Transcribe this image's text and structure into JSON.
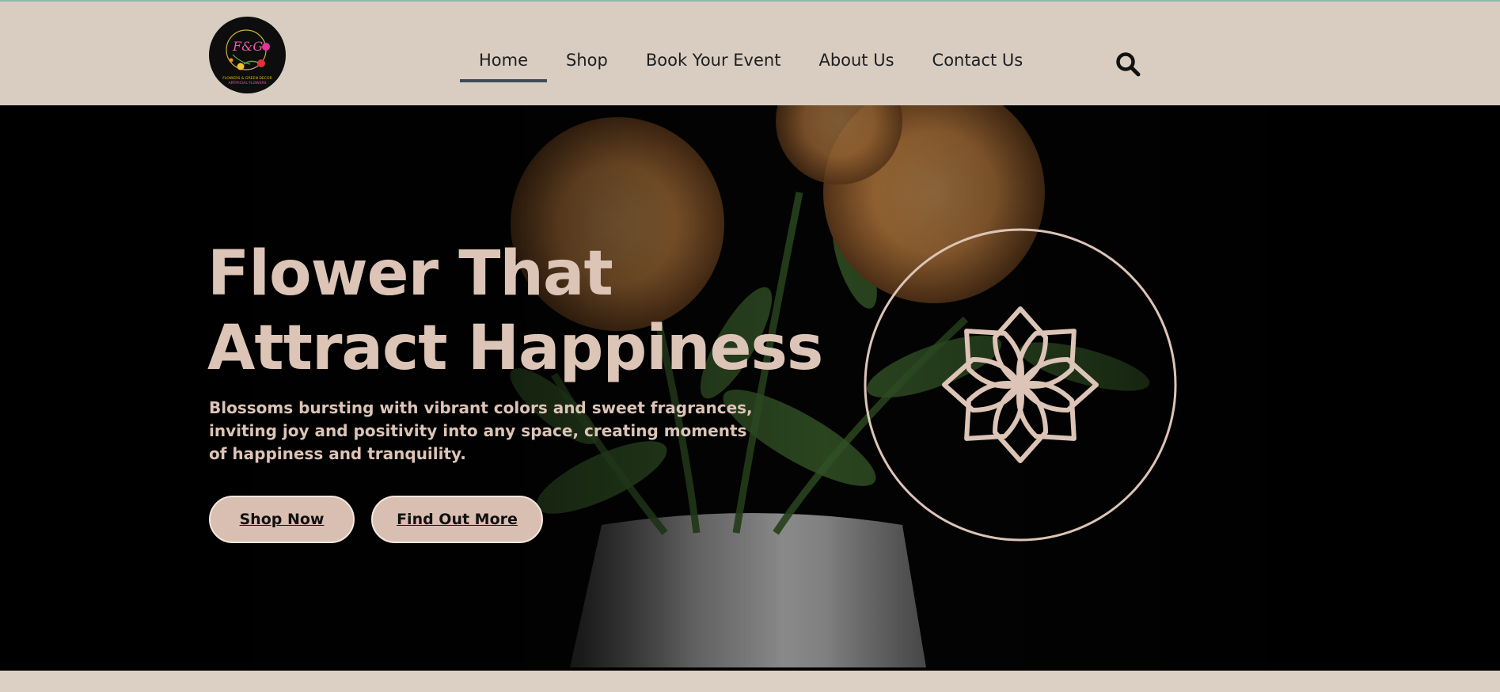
{
  "brand": {
    "logo_text_top": "F&G",
    "logo_text_line1": "FLOWERS & GREEN DECOR",
    "logo_text_line2": "ARTIFICIAL FLOWERS"
  },
  "nav": {
    "items": [
      {
        "label": "Home",
        "active": true
      },
      {
        "label": "Shop",
        "active": false
      },
      {
        "label": "Book Your Event",
        "active": false
      },
      {
        "label": "About Us",
        "active": false
      },
      {
        "label": "Contact Us",
        "active": false
      }
    ],
    "search_icon": "search-icon"
  },
  "hero": {
    "title_line1": "Flower That",
    "title_line2": "Attract Happiness",
    "subtitle": "Blossoms bursting with vibrant colors and sweet fragrances, inviting joy and positivity into any space, creating moments of happiness and tranquility.",
    "primary_button": "Shop Now",
    "secondary_button": "Find Out More",
    "emblem_icon": "lotus-icon"
  },
  "colors": {
    "header_bg": "#d9cdc2",
    "accent": "#dcc4b6",
    "button_bg": "#d9bfb1",
    "nav_underline": "#3f4c57"
  }
}
